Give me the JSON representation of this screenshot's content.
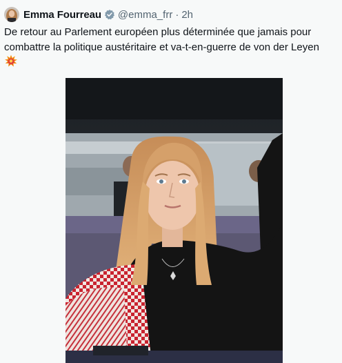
{
  "tweet": {
    "author_name": "Emma Fourreau",
    "handle": "@emma_frr",
    "separator": "·",
    "time": "2h",
    "text_line_1": "De retour au Parlement européen plus déterminée que jamais pour",
    "text_line_2": "combattre la politique austéritaire et va-t-en-guerre de von der Leyen",
    "emoji": "💥"
  },
  "icons": {
    "verified": "verified-badge-icon",
    "emoji": "collision-emoji-icon"
  },
  "colors": {
    "background": "#f7f9f9",
    "text": "#0f1419",
    "secondary_text": "#536471",
    "verified_badge": "#829aab"
  }
}
